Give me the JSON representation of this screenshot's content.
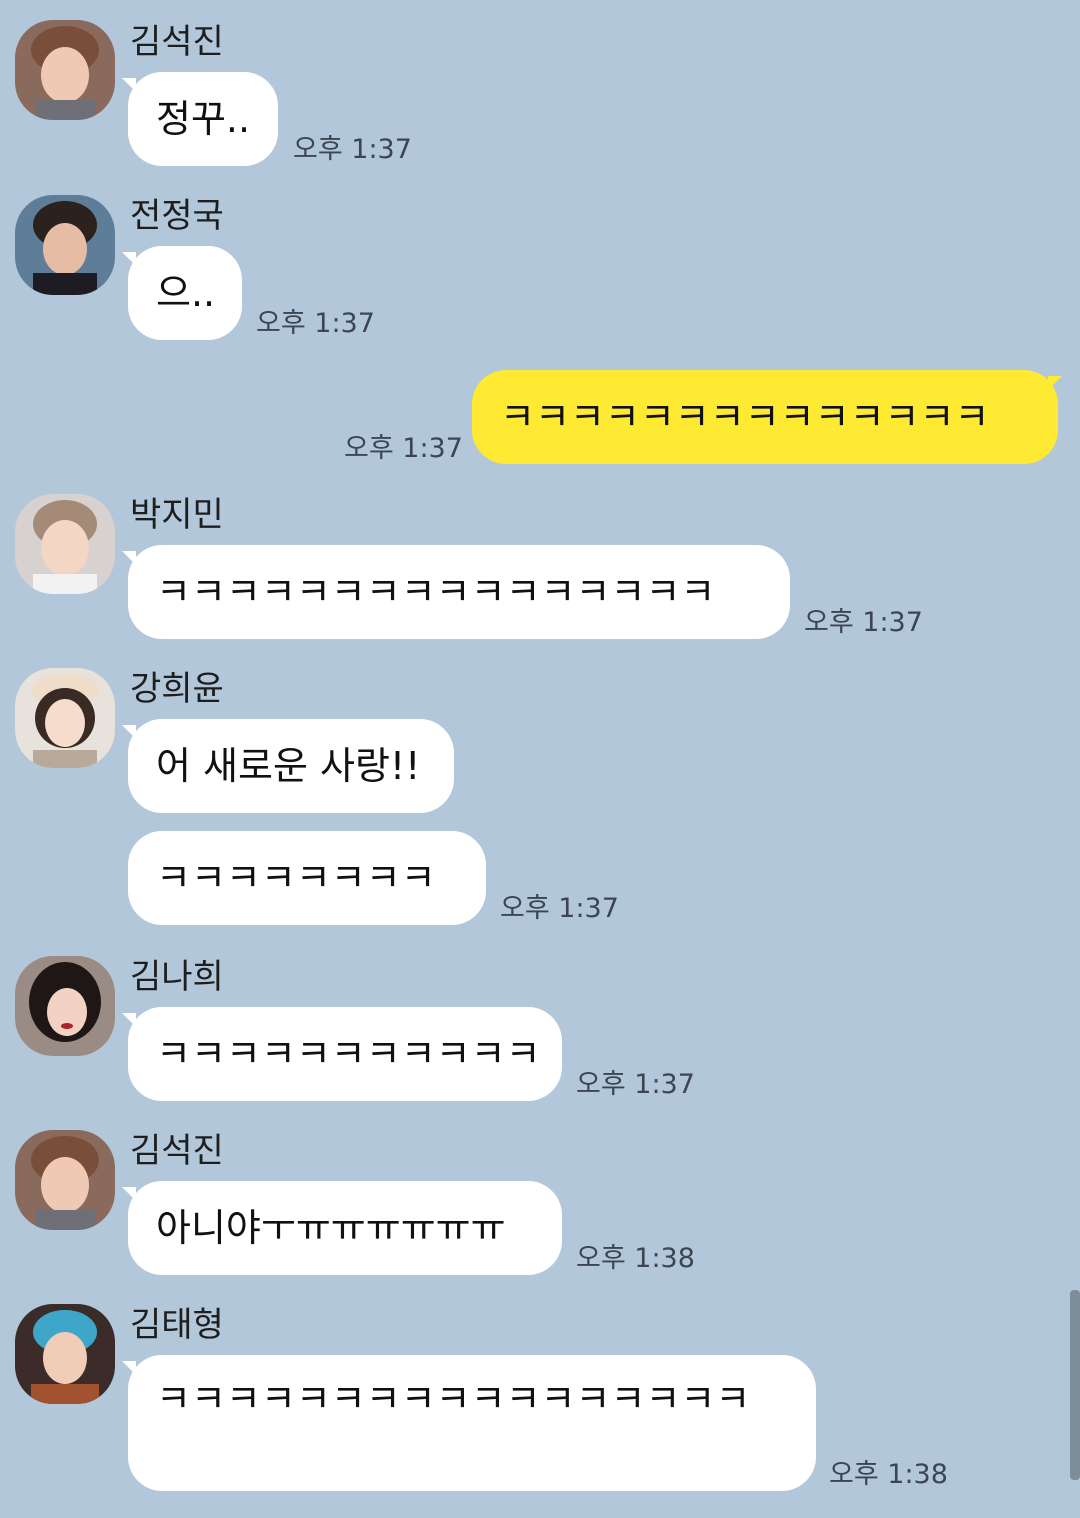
{
  "colors": {
    "background": "#b2c7da",
    "incoming_bubble": "#ffffff",
    "outgoing_bubble": "#fee933",
    "timestamp": "#3c4652"
  },
  "messages": [
    {
      "sender": "김석진",
      "avatar": "profile-photo",
      "text": "정꾸..",
      "time": "오후 1:37"
    },
    {
      "sender": "전정국",
      "avatar": "profile-photo",
      "text": "으..",
      "time": "오후 1:37"
    },
    {
      "sender": "",
      "mine": true,
      "text": "ㅋㅋㅋㅋㅋㅋㅋㅋㅋㅋㅋㅋㅋㅋ",
      "time": "오후 1:37"
    },
    {
      "sender": "박지민",
      "avatar": "profile-photo",
      "text": "ㅋㅋㅋㅋㅋㅋㅋㅋㅋㅋㅋㅋㅋㅋㅋㅋ",
      "time": "오후 1:37"
    },
    {
      "sender": "강희윤",
      "avatar": "profile-photo",
      "text": "어 새로운 사랑!!",
      "time": ""
    },
    {
      "sender": "",
      "text": "ㅋㅋㅋㅋㅋㅋㅋㅋ",
      "time": "오후 1:37"
    },
    {
      "sender": "김나희",
      "avatar": "profile-photo",
      "text": "ㅋㅋㅋㅋㅋㅋㅋㅋㅋㅋㅋ",
      "time": "오후 1:37"
    },
    {
      "sender": "김석진",
      "avatar": "profile-photo",
      "text": "아니야ㅜㅠㅠㅠㅠㅠㅠ",
      "time": "오후 1:38"
    },
    {
      "sender": "김태형",
      "avatar": "profile-photo",
      "text": "ㅋㅋㅋㅋㅋㅋㅋㅋㅋㅋㅋㅋㅋㅋㅋㅋㅋ",
      "time": "오후 1:38"
    }
  ]
}
